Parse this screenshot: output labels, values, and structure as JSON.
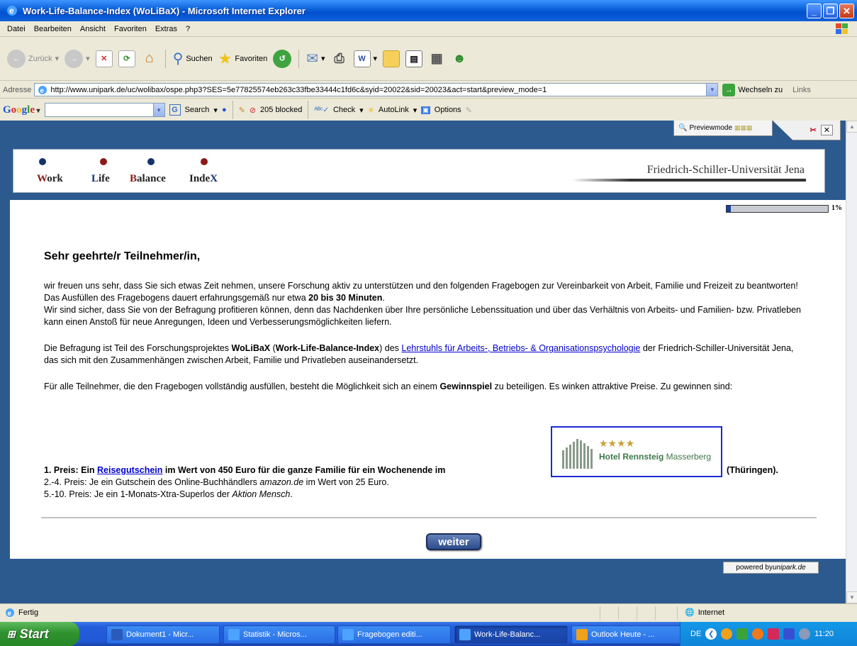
{
  "window": {
    "title": "Work-Life-Balance-Index (WoLiBaX) - Microsoft Internet Explorer"
  },
  "menu": [
    "Datei",
    "Bearbeiten",
    "Ansicht",
    "Favoriten",
    "Extras",
    "?"
  ],
  "toolbar": {
    "back_label": "Zurück",
    "search_label": "Suchen",
    "favorites_label": "Favoriten"
  },
  "address": {
    "label": "Adresse",
    "url": "http://www.unipark.de/uc/wolibax/ospe.php3?SES=5e77825574eb263c33fbe33444c1fd6c&syid=20022&sid=20023&act=start&preview_mode=1",
    "go_label": "Wechseln zu",
    "links_label": "Links"
  },
  "google": {
    "logo": "Google",
    "search_label": "Search",
    "blocked_label": "205 blocked",
    "check_label": "Check",
    "autolink_label": "AutoLink",
    "options_label": "Options"
  },
  "preview": {
    "label": "Previewmode"
  },
  "header": {
    "logo_words": [
      "W",
      "ork",
      "L",
      "ife",
      "B",
      "alance",
      "Inde",
      "X"
    ],
    "university": "Friedrich-Schiller-Universität Jena"
  },
  "progress": {
    "value": 0.01,
    "label": "1%"
  },
  "survey": {
    "greeting": "Sehr geehrte/r Teilnehmer/in,",
    "p1_a": "wir freuen uns sehr, dass Sie sich etwas Zeit nehmen, unsere Forschung aktiv zu unterstützen und den folgenden Fragebogen zur Vereinbarkeit von Arbeit, Familie und Freizeit zu beantworten! Das Ausfüllen des Fragebogens dauert erfahrungsgemäß nur etwa ",
    "p1_bold": "20 bis 30 Minuten",
    "p1_b": ".",
    "p1_c": "Wir sind sicher, dass Sie von der Befragung profitieren können, denn das Nachdenken über Ihre persönliche Lebenssituation und über das Verhältnis von Arbeits- und Familien- bzw. Privatleben kann einen Anstoß für neue Anregungen, Ideen und Verbesserungsmöglichkeiten liefern.",
    "p2_a": "Die Befragung ist Teil des Forschungsprojektes ",
    "p2_bold1": "WoLiBaX",
    "p2_b": " (",
    "p2_bold2": "Work-Life-Balance-Index",
    "p2_c": ") des ",
    "p2_link": "Lehrstuhls für Arbeits-, Betriebs- & Organisationspsychologie",
    "p2_d": " der Friedrich-Schiller-Universität Jena, das sich mit den Zusammenhängen zwischen Arbeit, Familie und Privatleben auseinandersetzt.",
    "p3_a": "Für alle Teilnehmer, die den Fragebogen vollständig ausfüllen, besteht die Möglichkeit sich an einem ",
    "p3_bold": "Gewinnspiel",
    "p3_b": " zu beteiligen. Es winken attraktive Preise. Zu gewinnen sind:",
    "prize1_a": "1. Preis: Ein ",
    "prize1_link": "Reisegutschein",
    "prize1_b": " im Wert von 450 Euro für die ganze Familie für ein Wochenende im",
    "prize1_c": "(Thüringen).",
    "prize2_a": "2.-4. Preis: Je ein Gutschein des Online-Buchhändlers ",
    "prize2_italic": "amazon.de",
    "prize2_b": " im Wert von 25 Euro.",
    "prize3_a": "5.-10. Preis: Je ein 1-Monats-Xtra-Superlos der ",
    "prize3_italic": "Aktion Mensch",
    "prize3_b": ".",
    "hotel_stars": "★★★★",
    "hotel_name_bold": "Hotel Rennsteig",
    "hotel_name_rest": " Masserberg",
    "next_button": "weiter",
    "powered_a": "powered by ",
    "powered_b": "unipark.de"
  },
  "status": {
    "text": "Fertig",
    "zone": "Internet"
  },
  "taskbar": {
    "start": "Start",
    "tasks": [
      "Dokument1 - Micr...",
      "Statistik - Micros...",
      "Fragebogen editi...",
      "Work-Life-Balanc...",
      "Outlook Heute - ..."
    ],
    "lang": "DE",
    "time": "11:20"
  },
  "colors": {
    "work": "#8b1a1a",
    "blue_dot": "#13336e",
    "index": "#1a2a6e",
    "page_bg": "#2c5a8e"
  }
}
